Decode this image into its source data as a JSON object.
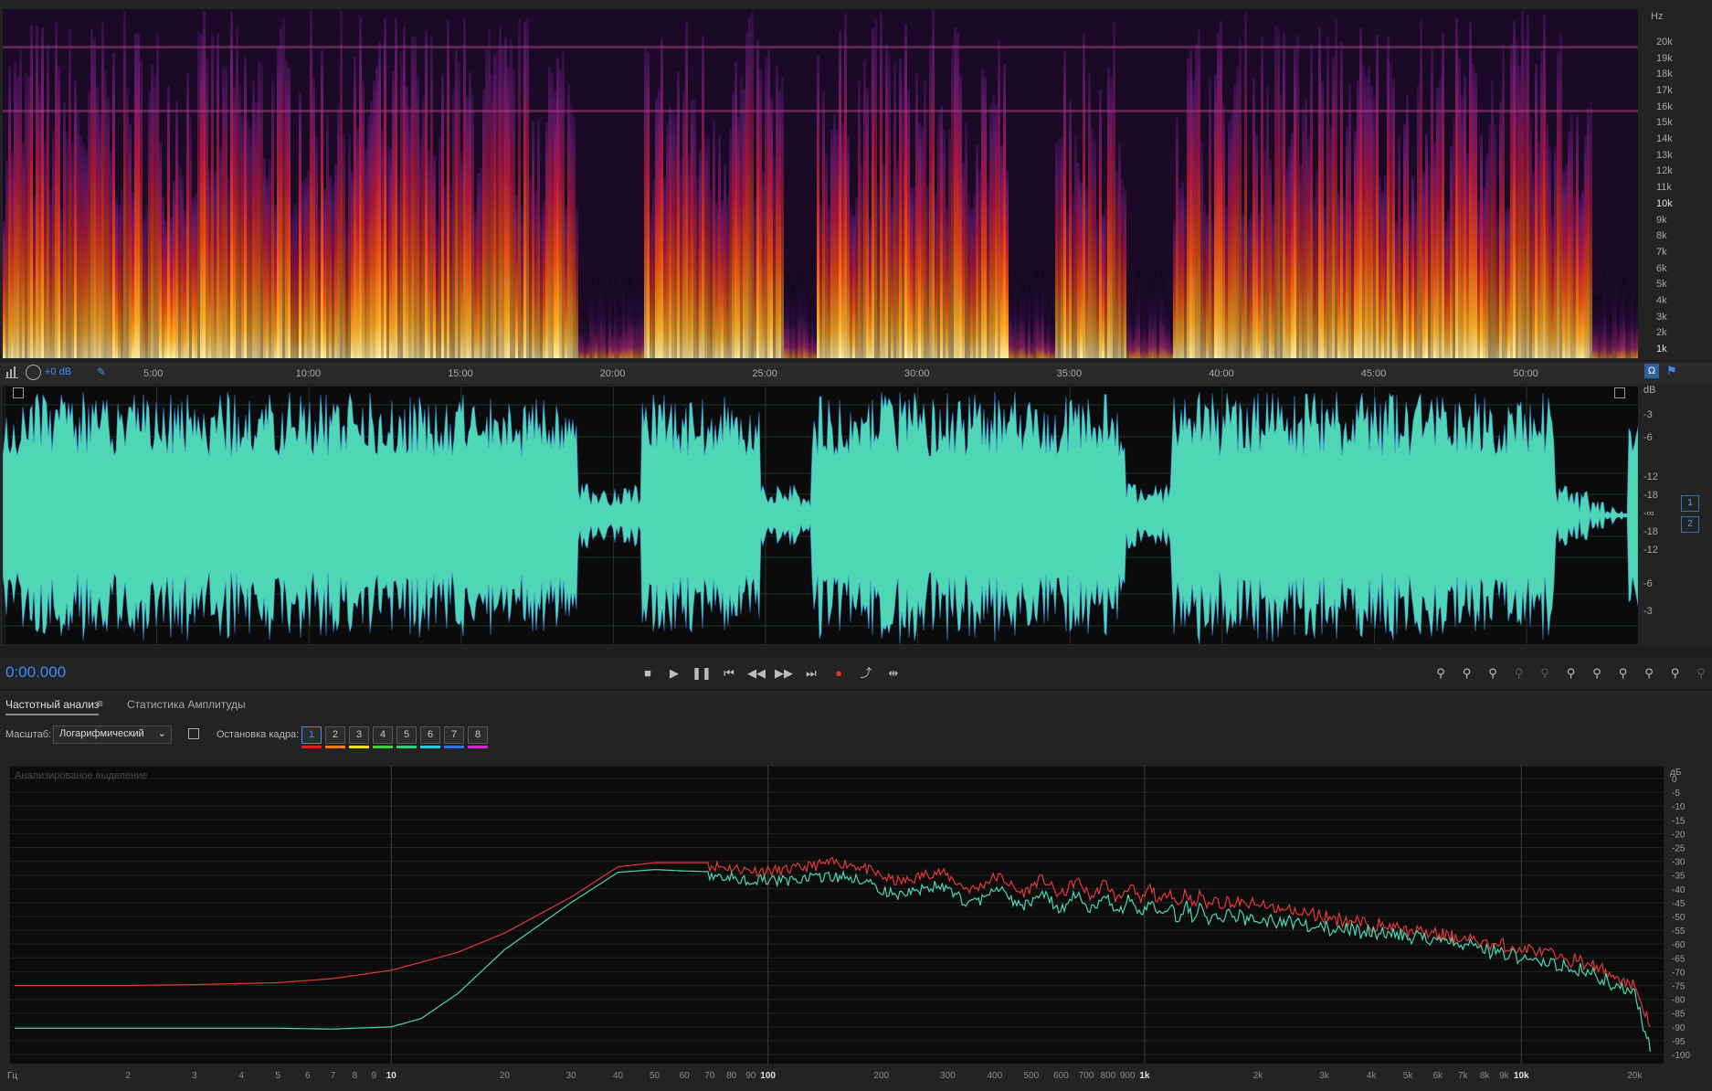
{
  "spectral": {
    "unit_label": "Hz",
    "freq_ticks": [
      "20k",
      "19k",
      "18k",
      "17k",
      "16k",
      "15k",
      "14k",
      "13k",
      "12k",
      "11k",
      "10k",
      "9k",
      "8k",
      "7k",
      "6k",
      "5k",
      "4k",
      "3k",
      "2k",
      "1k"
    ]
  },
  "timeline": {
    "gain_label": "+0 dB",
    "ticks": [
      "5:00",
      "10:00",
      "15:00",
      "20:00",
      "25:00",
      "30:00",
      "35:00",
      "40:00",
      "45:00",
      "50:00"
    ]
  },
  "waveform": {
    "unit_label": "dB",
    "db_ticks_top": [
      "-3",
      "-6",
      "-12",
      "-18",
      "-∞"
    ],
    "db_ticks_bottom": [
      "-18",
      "-12",
      "-6",
      "-3"
    ],
    "channels": [
      "1",
      "2"
    ],
    "color": "#4fd6b4"
  },
  "transport": {
    "time": "0:00.000",
    "stop_icon": "stop-icon",
    "play_icon": "play-icon",
    "pause_icon": "pause-icon"
  },
  "freq_panel": {
    "tab_active": "Частотный анализ",
    "tab_inactive": "Статистика Амплитуды",
    "scale_label": "Масштаб:",
    "scale_value": "Логарифмический",
    "freeze_label": "Остановка кадра:",
    "frames": [
      "1",
      "2",
      "3",
      "4",
      "5",
      "6",
      "7",
      "8"
    ],
    "frame_colors": [
      "#e02020",
      "#f07a10",
      "#f0e020",
      "#40d040",
      "#30d080",
      "#20d0e0",
      "#3070f0",
      "#e020e0"
    ],
    "plot_label": "Анализированое выделение",
    "x_unit": "Гц",
    "y_unit": "дБ"
  },
  "chart_data": {
    "type": "line",
    "xlabel": "Гц",
    "ylabel": "дБ",
    "x_scale": "log",
    "xlim": [
      1,
      24000
    ],
    "ylim": [
      -100,
      0
    ],
    "x_ticks": [
      "2",
      "3",
      "4",
      "5",
      "6",
      "7",
      "8",
      "9",
      "10",
      "20",
      "30",
      "40",
      "50",
      "60",
      "70",
      "80",
      "90",
      "100",
      "200",
      "300",
      "400",
      "500",
      "600",
      "700",
      "800",
      "900",
      "1k",
      "2k",
      "3k",
      "4k",
      "5k",
      "6k",
      "7k",
      "8k",
      "9k",
      "10k",
      "20k"
    ],
    "y_ticks": [
      "0",
      "-5",
      "-10",
      "-15",
      "-20",
      "-25",
      "-30",
      "-35",
      "-40",
      "-45",
      "-50",
      "-55",
      "-60",
      "-65",
      "-70",
      "-75",
      "-80",
      "-85",
      "-90",
      "-95",
      "-100"
    ],
    "series": [
      {
        "color": "#e23a3a",
        "x": [
          1,
          2,
          3,
          5,
          7,
          10,
          15,
          20,
          30,
          40,
          50,
          60,
          80,
          100,
          150,
          200,
          300,
          500,
          700,
          1000,
          2000,
          3000,
          5000,
          7000,
          10000,
          15000,
          20000,
          22000
        ],
        "y": [
          -75,
          -75,
          -74.7,
          -74,
          -72.5,
          -69.5,
          -63,
          -56,
          -43,
          -32,
          -30.5,
          -30.5,
          -30.5,
          -31,
          -33,
          -34,
          -37,
          -39,
          -40,
          -42,
          -46,
          -50,
          -55,
          -58,
          -62,
          -67,
          -75,
          -90
        ]
      },
      {
        "color": "#4fd6b4",
        "x": [
          1,
          2,
          3,
          5,
          7,
          10,
          12,
          15,
          20,
          30,
          40,
          50,
          60,
          80,
          100,
          150,
          200,
          300,
          500,
          700,
          1000,
          2000,
          3000,
          5000,
          7000,
          10000,
          15000,
          20000,
          22000
        ],
        "y": [
          -90.5,
          -90.5,
          -90.5,
          -90.5,
          -90.8,
          -90,
          -87,
          -78,
          -62,
          -45,
          -34,
          -33,
          -33.5,
          -34,
          -34.5,
          -38,
          -39,
          -42,
          -44,
          -45,
          -47,
          -51,
          -54,
          -57,
          -60,
          -65,
          -70,
          -79,
          -99
        ]
      }
    ]
  }
}
